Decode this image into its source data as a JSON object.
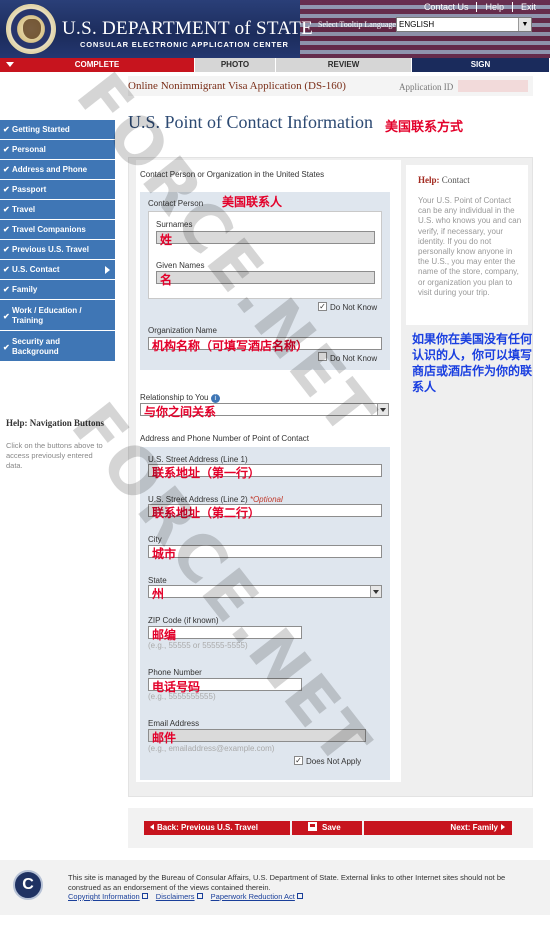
{
  "header": {
    "title": "U.S. DEPARTMENT of STATE",
    "subtitle": "CONSULAR ELECTRONIC APPLICATION CENTER",
    "links": [
      "Contact Us",
      "Help",
      "Exit"
    ],
    "lang_label": "Select Tooltip Language",
    "lang_value": "ENGLISH"
  },
  "steps": [
    "COMPLETE",
    "PHOTO",
    "REVIEW",
    "SIGN"
  ],
  "sidebar": {
    "items": [
      {
        "label": "Getting Started"
      },
      {
        "label": "Personal"
      },
      {
        "label": "Address and Phone"
      },
      {
        "label": "Passport"
      },
      {
        "label": "Travel"
      },
      {
        "label": "Travel Companions"
      },
      {
        "label": "Previous U.S. Travel"
      },
      {
        "label": "U.S. Contact"
      },
      {
        "label": "Family"
      },
      {
        "label": "Work / Education / Training"
      },
      {
        "label": "Security and Background"
      }
    ],
    "help_title_prefix": "Help:",
    "help_title": "Navigation Buttons",
    "help_text": "Click on the buttons above to access previously entered data."
  },
  "form": {
    "title": "Online Nonimmigrant Visa Application (DS-160)",
    "app_id_label": "Application ID",
    "heading": "U.S. Point of Contact Information",
    "heading_annotation": "美国联系方式",
    "section1": "Contact Person or Organization in the United States",
    "contact_person": "Contact Person",
    "contact_person_annotation": "美国联系人",
    "surnames": "Surnames",
    "surnames_value": "姓",
    "given_names": "Given Names",
    "given_names_value": "名",
    "do_not_know": "Do Not Know",
    "org_name": "Organization Name",
    "org_value": "机构名称（可填写酒店名称）",
    "relationship": "Relationship to You",
    "relationship_value": "与你之间关系",
    "section2": "Address and Phone Number of Point of Contact",
    "street1": "U.S. Street Address (Line 1)",
    "street1_value": "联系地址（第一行）",
    "street2": "U.S. Street Address (Line 2)",
    "optional": "*Optional",
    "street2_value": "联系地址（第二行）",
    "city": "City",
    "city_value": "城市",
    "state": "State",
    "state_value": "州",
    "zip": "ZIP Code (if known)",
    "zip_value": "邮编",
    "zip_hint": "(e.g., 55555 or 55555-5555)",
    "phone": "Phone Number",
    "phone_value": "电话号码",
    "phone_hint": "(e.g., 5555555555)",
    "email": "Email Address",
    "email_value": "邮件",
    "email_hint": "(e.g., emailaddress@example.com)",
    "does_not_apply": "Does Not Apply"
  },
  "help": {
    "title_prefix": "Help:",
    "title": "Contact",
    "text": "Your U.S. Point of Contact can be any individual in the U.S. who knows you and can verify, if necessary, your identity. If you do not personally know anyone in the U.S., you may enter the name of the store, company, or organization you plan to visit during your trip.",
    "annotation": "如果你在美国没有任何认识的人，你可以填写商店或酒店作为你的联系人"
  },
  "buttons": {
    "back": "Back: Previous U.S. Travel",
    "save": "Save",
    "next": "Next: Family"
  },
  "footer": {
    "text": "This site is managed by the Bureau of Consular Affairs, U.S. Department of State. External links to other Internet sites should not be construed as an endorsement of the views contained therein.",
    "links": [
      "Copyright Information",
      "Disclaimers",
      "Paperwork Reduction Act"
    ]
  },
  "watermark": "FORCE.NET",
  "colors": {
    "nav_blue": "#3f76b5",
    "accent_red": "#c7141e",
    "annotation_red": "#e3002a",
    "annotation_blue": "#1a3fe0"
  }
}
